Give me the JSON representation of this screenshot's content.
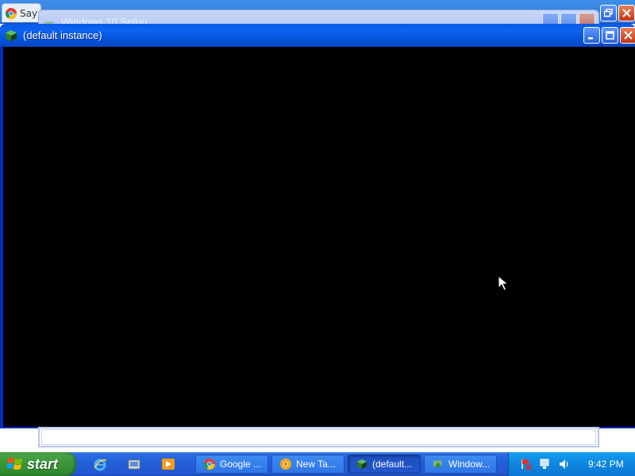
{
  "background_browser": {
    "tab_label": "Say"
  },
  "background_setup": {
    "title": "Windows 10 Setup"
  },
  "main_window": {
    "title": "(default instance)"
  },
  "taskbar": {
    "start_label": "start",
    "quick_launch": [
      "internet-explorer-icon",
      "explorer-folder-icon",
      "media-player-icon"
    ],
    "tasks": [
      {
        "label": "Google ...",
        "icon": "chrome-icon",
        "active": false
      },
      {
        "label": "New Ta...",
        "icon": "chrome-canary-icon",
        "active": false
      },
      {
        "label": "(default...",
        "icon": "cube-icon",
        "active": true
      },
      {
        "label": "Window...",
        "icon": "setup-icon",
        "active": false
      }
    ],
    "clock": "9:42 PM"
  },
  "colors": {
    "titlebar": "#0b63f0",
    "taskbar": "#225ed7",
    "start": "#3c9a3a",
    "tray": "#0f86de",
    "content": "#000000"
  }
}
